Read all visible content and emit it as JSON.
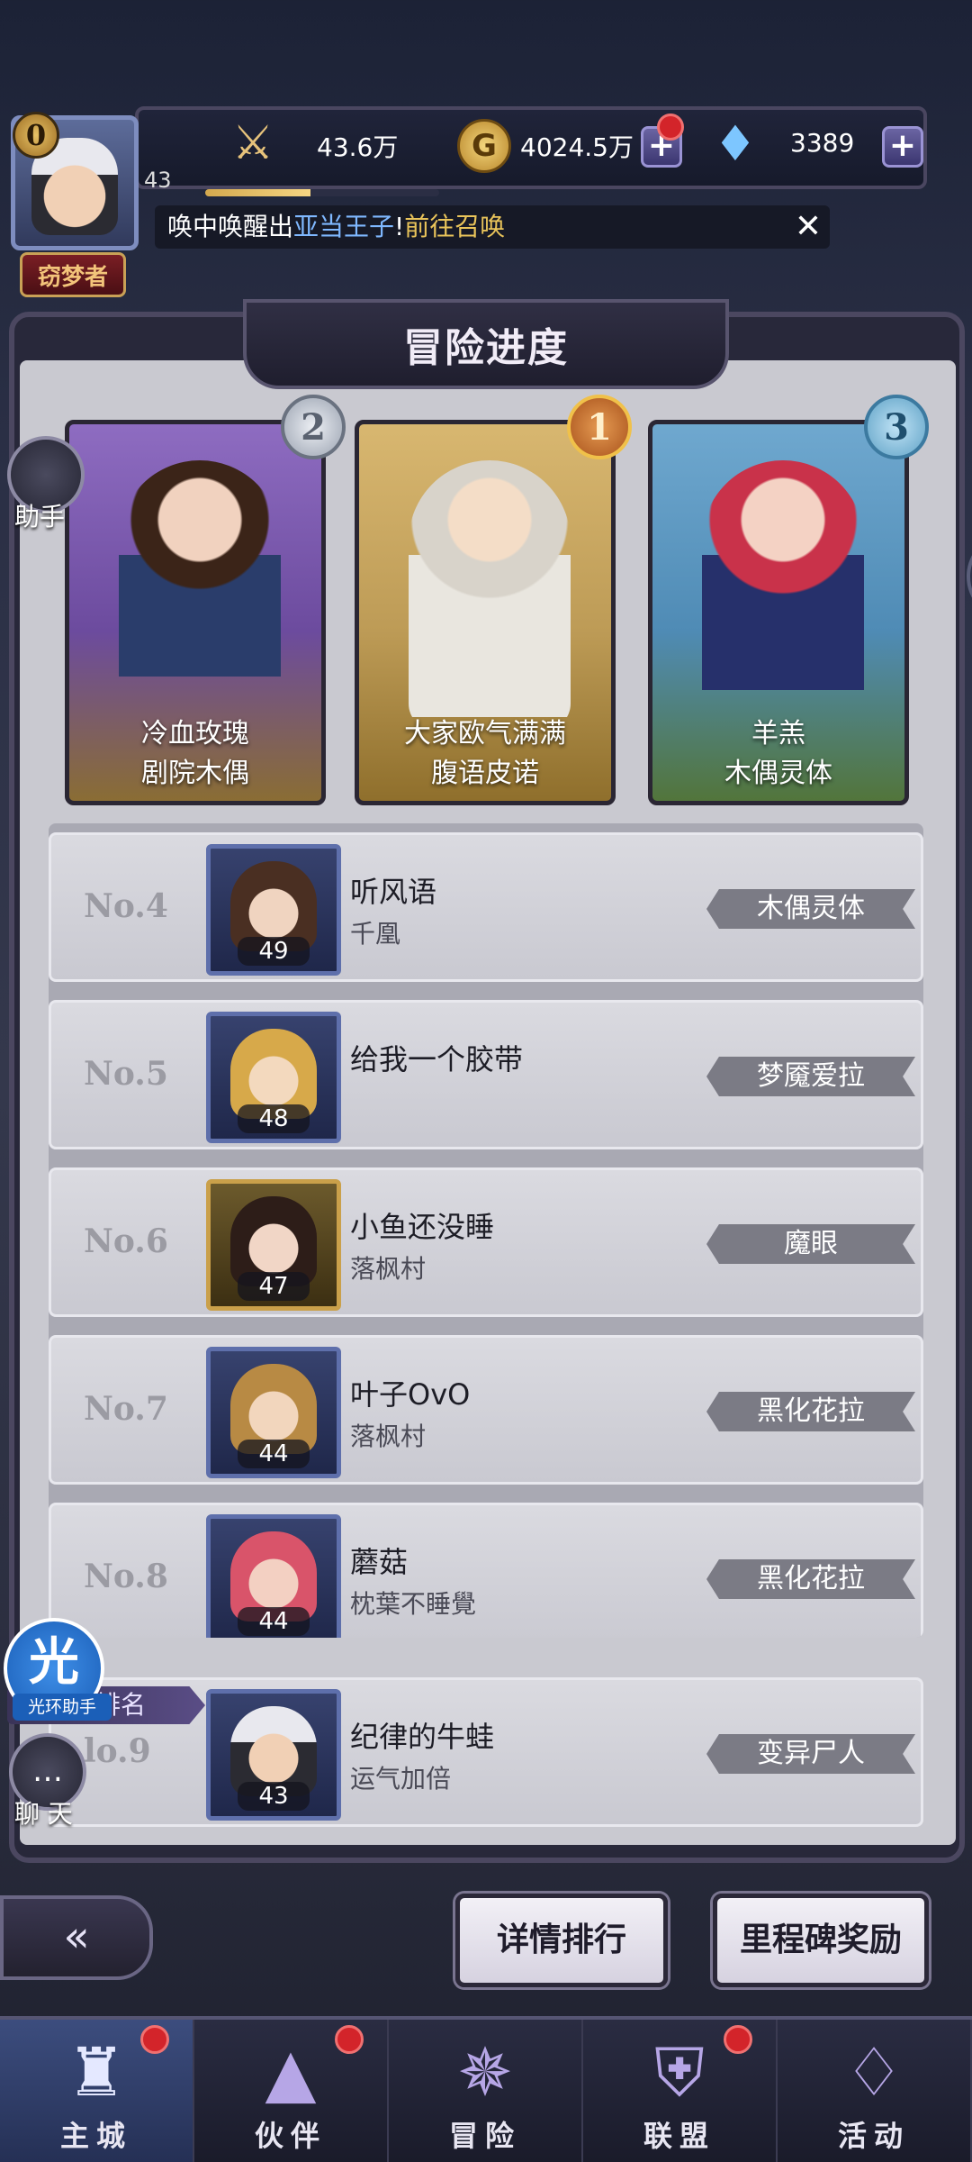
{
  "hud": {
    "player_level": "0",
    "title_badge": "窃梦者",
    "exp_level": "43",
    "exp_progress": 0.45,
    "power": "43.6万",
    "gold": "4024.5万",
    "gems": "3389",
    "ticker_prefix": "唤中唤醒出",
    "ticker_hero": "亚当王子",
    "ticker_bang": "!",
    "ticker_action": "前往召唤"
  },
  "panel": {
    "title": "冒险进度"
  },
  "top3": [
    {
      "rank": "2",
      "player": "冷血玫瑰",
      "hero": "剧院木偶"
    },
    {
      "rank": "1",
      "player": "大家欧气满满",
      "hero": "腹语皮诺"
    },
    {
      "rank": "3",
      "player": "羊羔",
      "hero": "木偶灵体"
    }
  ],
  "rows": [
    {
      "rank": "No.4",
      "level": "49",
      "player": "听风语",
      "guild": "千凰",
      "hero": "木偶灵体"
    },
    {
      "rank": "No.5",
      "level": "48",
      "player": "给我一个胶带",
      "guild": "",
      "hero": "梦魇爱拉"
    },
    {
      "rank": "No.6",
      "level": "47",
      "player": "小鱼还没睡",
      "guild": "落枫村",
      "hero": "魔眼"
    },
    {
      "rank": "No.7",
      "level": "44",
      "player": "叶子OvO",
      "guild": "落枫村",
      "hero": "黑化花拉"
    },
    {
      "rank": "No.8",
      "level": "44",
      "player": "蘑菇",
      "guild": "枕葉不睡覺",
      "hero": "黑化花拉"
    }
  ],
  "my_rank": {
    "label": "的排名",
    "rank": "lo.9",
    "level": "43",
    "player": "纪律的牛蛙",
    "guild": "运气加倍",
    "hero": "变异尸人"
  },
  "side": {
    "helper": "助手",
    "chat": "聊 天",
    "guang": "光",
    "guang_label": "光环助手"
  },
  "buttons": {
    "back": "«",
    "detail": "详情排行",
    "milestone": "里程碑奖励"
  },
  "nav": [
    {
      "label": "主城",
      "icon": "castle-icon",
      "active": true,
      "dot": true
    },
    {
      "label": "伙伴",
      "icon": "witch-hat-icon",
      "active": false,
      "dot": true
    },
    {
      "label": "冒险",
      "icon": "compass-icon",
      "active": false,
      "dot": false
    },
    {
      "label": "联盟",
      "icon": "shield-icon",
      "active": false,
      "dot": true
    },
    {
      "label": "活动",
      "icon": "cards-icon",
      "active": false,
      "dot": false
    }
  ],
  "colors": {
    "accent_gold": "#e9c45a",
    "accent_blue": "#7fb8ff",
    "notify_red": "#d3242a"
  }
}
